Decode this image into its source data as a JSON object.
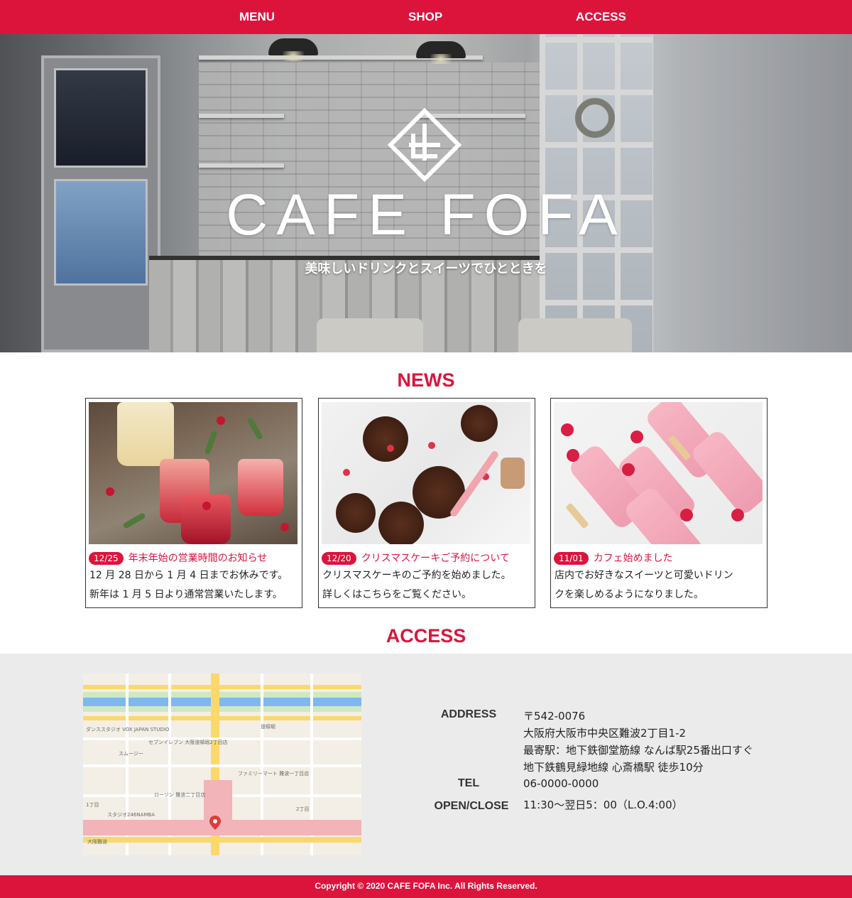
{
  "nav": {
    "items": [
      {
        "label": "MENU"
      },
      {
        "label": "SHOP"
      },
      {
        "label": "ACCESS"
      }
    ]
  },
  "hero": {
    "title": "CAFE FOFA",
    "tagline": "美味しいドリンクとスイーツでひとときを"
  },
  "news": {
    "heading": "NEWS",
    "items": [
      {
        "date": "12/25",
        "title": "年末年始の営業時間のお知らせ",
        "body_line1": "12 月 28 日から 1 月 4 日までお休みです。",
        "body_line2": "新年は 1 月 5 日より通常営業いたします。"
      },
      {
        "date": "12/20",
        "title": "クリスマスケーキご予約について",
        "body_line1": "クリスマスケーキのご予約を始めました。",
        "body_line2": "詳しくはこちらをご覧ください。"
      },
      {
        "date": "11/01",
        "title": "カフェ始めました",
        "body_line1": "店内でお好きなスイーツと可愛いドリン",
        "body_line2": "クを楽しめるようになりました。"
      }
    ]
  },
  "access": {
    "heading": "ACCESS",
    "address_label": "ADDRESS",
    "address_lines": [
      "〒542-0076",
      "大阪府大阪市中央区難波2丁目1-2",
      "最寄駅：地下鉄御堂筋線 なんば駅25番出口すぐ",
      "地下鉄鶴見緑地線 心斎橋駅 徒歩10分"
    ],
    "tel_label": "TEL",
    "tel": "06-0000-0000",
    "hours_label": "OPEN/CLOSE",
    "hours": "11:30〜翌日5：00（L.O.4:00）",
    "map_labels": [
      "ダンススタジオ VOX JAPAN STUDIO",
      "セブンイレブン 大阪道頓堀2丁目店",
      "スムージー",
      "ファミリーマート 難波一丁目店",
      "ローソン 難波二丁目店",
      "スタジオ246NAMBA",
      "大阪難波",
      "道頓堀",
      "1丁目",
      "2丁目"
    ]
  },
  "footer": {
    "copyright": "Copyright © 2020 CAFE FOFA Inc. All Rights Reserved."
  },
  "colors": {
    "brand": "#dc143c",
    "band": "#ebebeb"
  },
  "icons": {
    "logo": "diamond-logo-icon"
  }
}
